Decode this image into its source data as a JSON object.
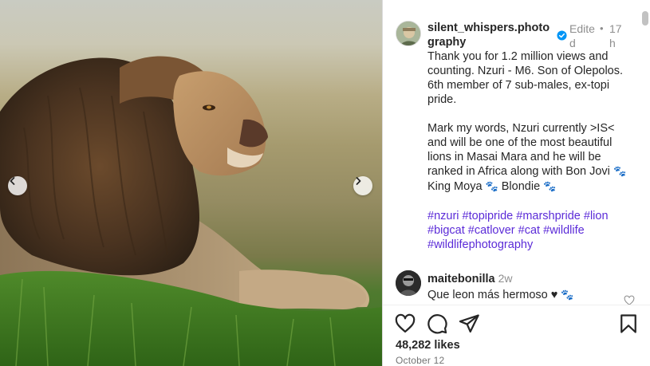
{
  "post": {
    "author": {
      "username": "silent_whispers.photography",
      "verified": true,
      "edited_label": "Edited",
      "separator": "•",
      "time_ago": "17h"
    },
    "caption": {
      "paragraph1": "Thank you for 1.2 million views and counting. Nzuri - M6. Son of Olepolos. 6th member of 7 sub-males, ex-topi pride.",
      "paragraph2_text": "Mark my words, Nzuri currently >IS< and will be one of the most beautiful lions in Masai Mara and he will be ranked in Africa along with Bon Jovi",
      "paw": "🐾",
      "name1": "King Moya",
      "name2": "Blondie",
      "hashtags": [
        "#nzuri",
        "#topipride",
        "#marshpride",
        "#lion",
        "#bigcat",
        "#catlover",
        "#cat",
        "#wildlife",
        "#wildlifephotography"
      ]
    },
    "comments": [
      {
        "username": "maitebonilla",
        "time_ago": "2w",
        "text": "Que leon más hermoso ♥",
        "paw": "🐾"
      }
    ],
    "likes": "48,282 likes",
    "date": "October 12"
  },
  "icons": {
    "like": "heart-icon",
    "comment": "comment-icon",
    "share": "share-icon",
    "save": "bookmark-icon",
    "prev": "chevron-left-icon",
    "next": "chevron-right-icon",
    "verified": "verified-badge-icon"
  },
  "colors": {
    "hashtag": "#5b2bd8",
    "verified": "#0095f6",
    "muted": "#8e8e8e"
  }
}
